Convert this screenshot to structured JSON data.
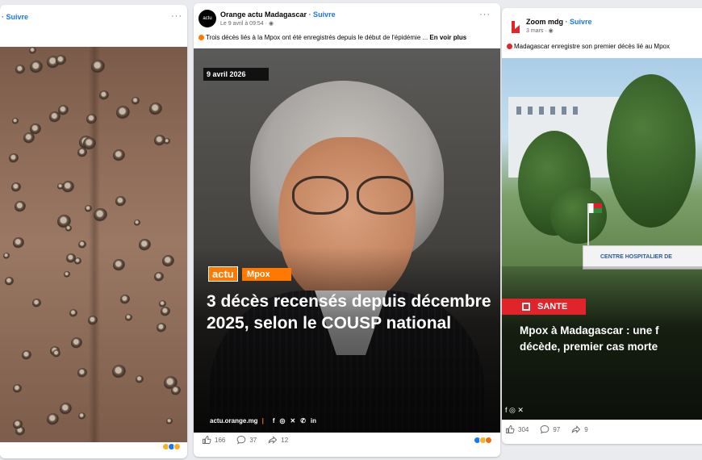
{
  "left_post": {
    "follow_label": "· Suivre",
    "more_label": "···"
  },
  "center_post": {
    "page_name": "Orange actu Madagascar",
    "follow_label": "· Suivre",
    "timestamp": "Le 9 avril à 09:54 ·",
    "more_label": "···",
    "avatar_text": "actu",
    "caption": "Trois décès liés à la Mpox ont été enregistrés depuis le début de l'épidémie ...",
    "see_more": "En voir plus",
    "video": {
      "date_badge": "9 avril 2026",
      "brand_label": "actu",
      "tag_label": "Mpox",
      "headline": "3 décès recensés depuis décembre 2025, selon le COUSP national",
      "site": "actu.orange.mg",
      "social_icons": [
        "facebook-icon",
        "instagram-icon",
        "x-icon",
        "whatsapp-icon",
        "linkedin-icon"
      ]
    },
    "likes": "166",
    "comments": "37",
    "shares": "12",
    "accent_color": "#ff7900"
  },
  "right_post": {
    "page_name": "Zoom mdg",
    "follow_label": "· Suivre",
    "timestamp": "3 mars ·",
    "caption": "Madagascar enregistre son premier décès lié au Mpox",
    "image": {
      "sign_text": "CENTRE HOSPITALIER DE",
      "category": "SANTE",
      "headline_line1": "Mpox à Madagascar : une f",
      "headline_line2": "décède, premier cas morte"
    },
    "likes": "304",
    "comments": "97",
    "shares": "9",
    "accent_color": "#e1242a"
  }
}
